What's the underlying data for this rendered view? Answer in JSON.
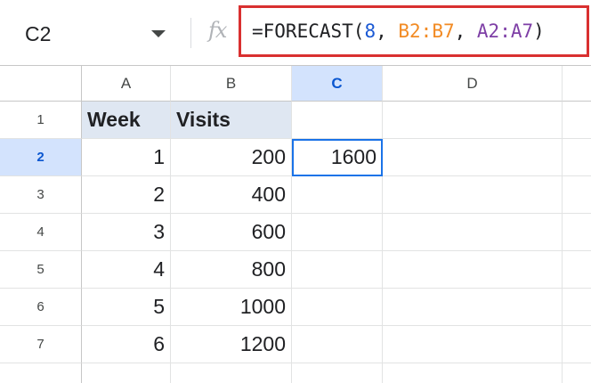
{
  "name_box": {
    "value": "C2",
    "caret_icon": "chevron-down-icon"
  },
  "formula_bar": {
    "fx_label": "fx",
    "tokens": {
      "fn": "=FORECAST(",
      "arg1": "8",
      "sep1": ", ",
      "arg2": "B2:B7",
      "sep2": ", ",
      "arg3": "A2:A7",
      "close": ")"
    },
    "colors": {
      "number": "#1a59d4",
      "range1": "#f28b24",
      "range2": "#7e3fa6",
      "highlight_border": "#d93030"
    }
  },
  "columns": [
    "A",
    "B",
    "C",
    "D"
  ],
  "selected_column": "C",
  "selected_row": "2",
  "rows": [
    {
      "num": "1",
      "a": "Week",
      "b": "Visits",
      "c": ""
    },
    {
      "num": "2",
      "a": "1",
      "b": "200",
      "c": "1600"
    },
    {
      "num": "3",
      "a": "2",
      "b": "400",
      "c": ""
    },
    {
      "num": "4",
      "a": "3",
      "b": "600",
      "c": ""
    },
    {
      "num": "5",
      "a": "4",
      "b": "800",
      "c": ""
    },
    {
      "num": "6",
      "a": "5",
      "b": "1000",
      "c": ""
    },
    {
      "num": "7",
      "a": "6",
      "b": "1200",
      "c": ""
    }
  ]
}
